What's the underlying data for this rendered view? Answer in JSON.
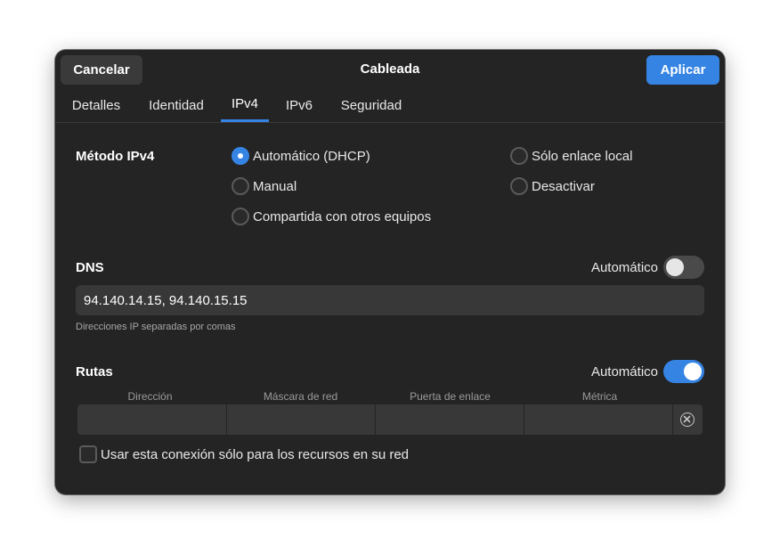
{
  "header": {
    "title": "Cableada",
    "cancel_label": "Cancelar",
    "apply_label": "Aplicar"
  },
  "tabs": [
    {
      "label": "Detalles",
      "active": false
    },
    {
      "label": "Identidad",
      "active": false
    },
    {
      "label": "IPv4",
      "active": true
    },
    {
      "label": "IPv6",
      "active": false
    },
    {
      "label": "Seguridad",
      "active": false
    }
  ],
  "method": {
    "label": "Método IPv4",
    "options": [
      {
        "label": "Automático (DHCP)",
        "checked": true
      },
      {
        "label": "Manual",
        "checked": false
      },
      {
        "label": "Compartida con otros equipos",
        "checked": false
      },
      {
        "label": "Sólo enlace local",
        "checked": false
      },
      {
        "label": "Desactivar",
        "checked": false
      }
    ]
  },
  "dns": {
    "label": "DNS",
    "auto_label": "Automático",
    "auto_on": false,
    "value": "94.140.14.15, 94.140.15.15",
    "hint": "Direcciones IP separadas por comas"
  },
  "routes": {
    "label": "Rutas",
    "auto_label": "Automático",
    "auto_on": true,
    "columns": [
      "Dirección",
      "Máscara de red",
      "Puerta de enlace",
      "Métrica"
    ]
  },
  "only_local": {
    "label": "Usar esta conexión sólo para los recursos en su red",
    "checked": false
  },
  "colors": {
    "accent": "#3584e4",
    "background": "#242424",
    "entry": "#383838"
  }
}
